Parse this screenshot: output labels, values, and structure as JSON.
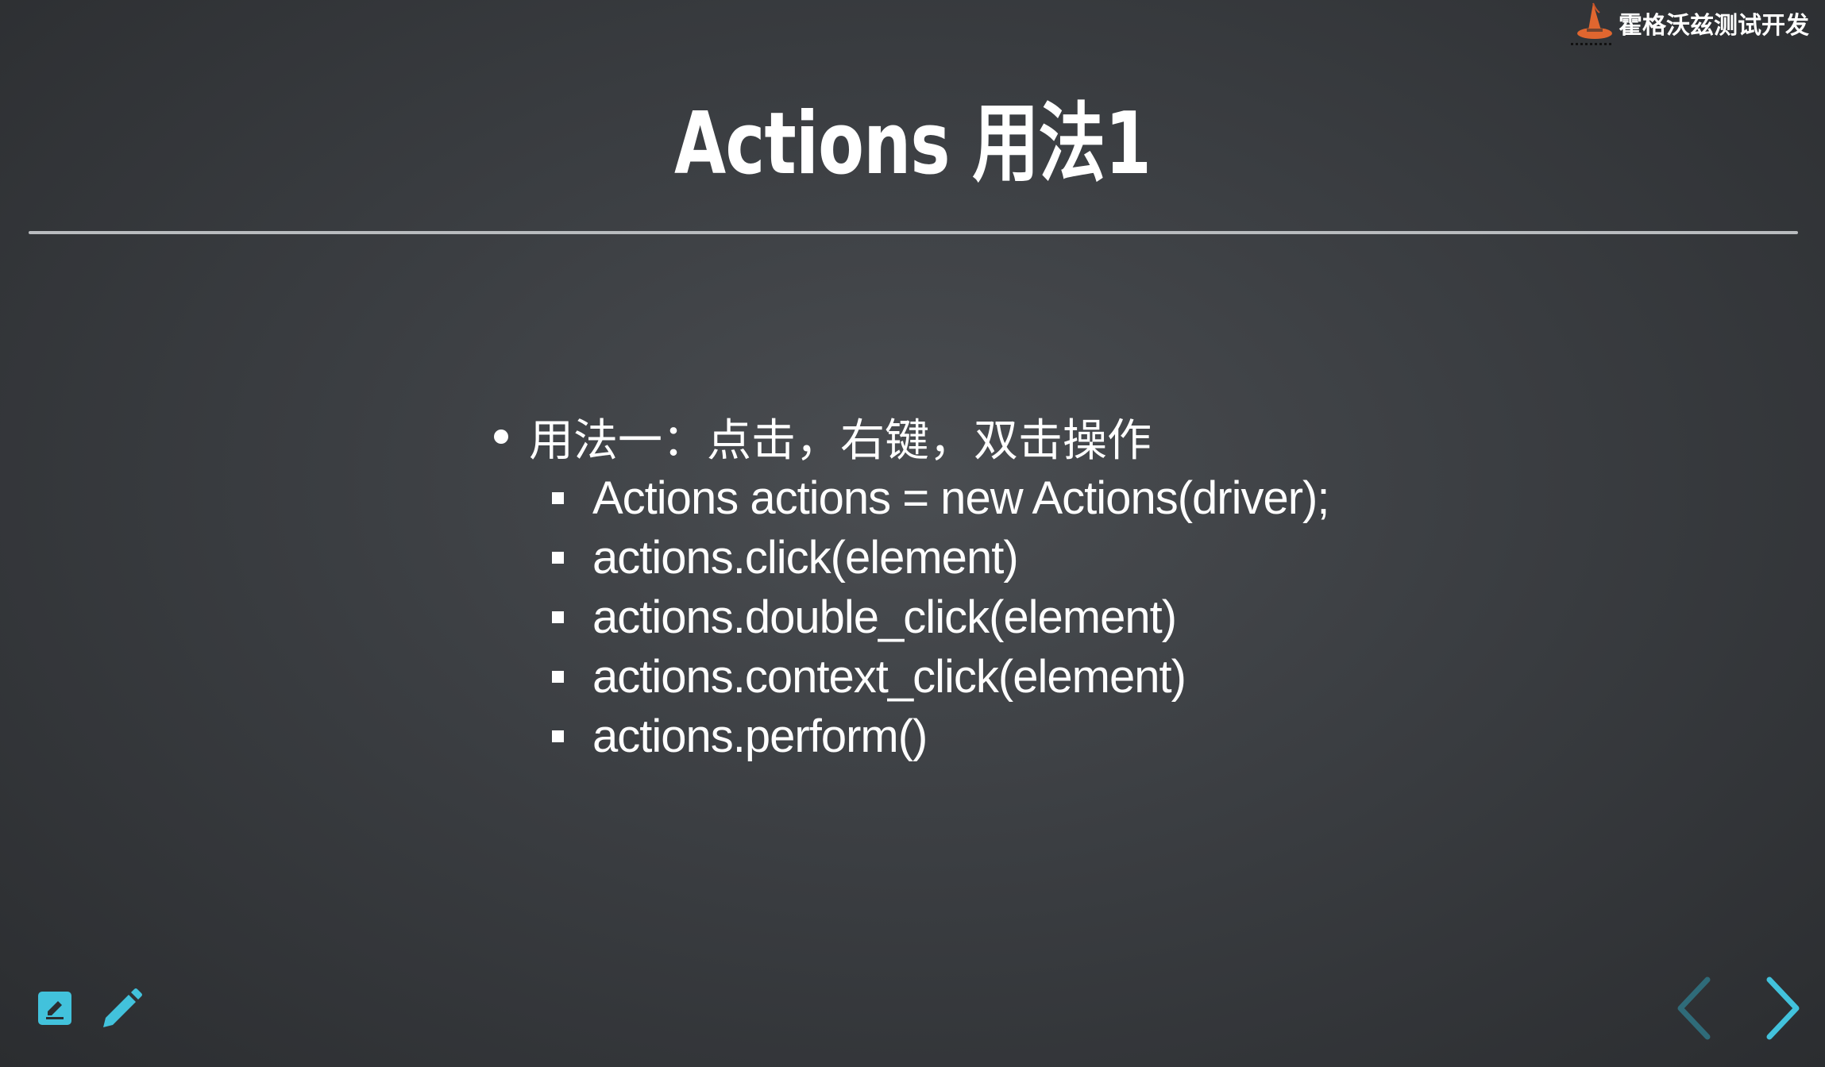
{
  "brand": {
    "name": "霍格沃兹测试开发",
    "logo_icon": "wizard-hat-icon",
    "accent": "#e0662f"
  },
  "slide": {
    "title": "Actions 用法1",
    "bullet": "用法一：点击，右键，双击操作",
    "items": [
      "Actions actions = new Actions(driver);",
      "actions.click(element)",
      "actions.double_click(element)",
      "actions.context_click(element)",
      "actions.perform()"
    ]
  },
  "controls": {
    "notes_icon": "speaker-notes-icon",
    "pen_icon": "pencil-icon",
    "prev_icon": "chevron-left-icon",
    "next_icon": "chevron-right-icon",
    "accent": "#42c2dc",
    "prev_enabled": false,
    "next_enabled": true
  }
}
